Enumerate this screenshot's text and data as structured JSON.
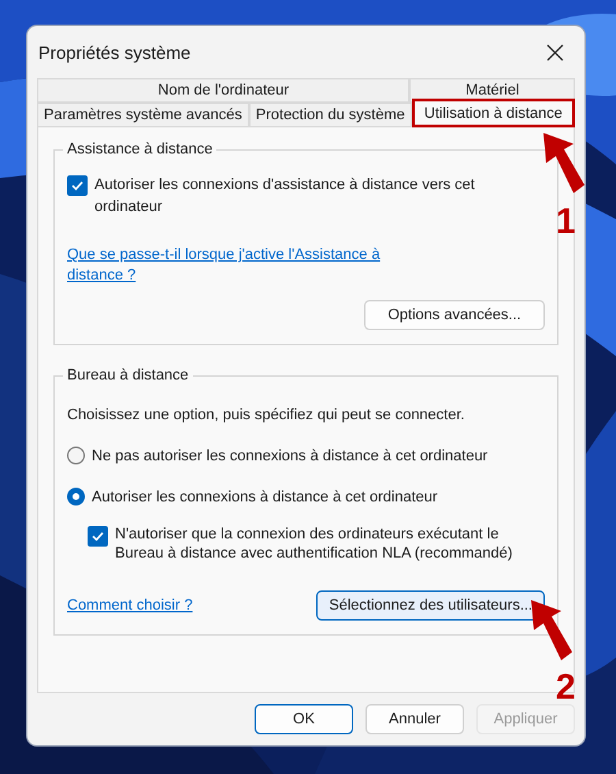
{
  "window": {
    "title": "Propriétés système"
  },
  "tab_rows": [
    {
      "tabs": [
        {
          "label": "Nom de l'ordinateur",
          "selected": false,
          "highlighted": false
        },
        {
          "label": "Matériel",
          "selected": false,
          "highlighted": false
        }
      ]
    },
    {
      "tabs": [
        {
          "label": "Paramètres système avancés",
          "selected": false,
          "highlighted": false
        },
        {
          "label": "Protection du système",
          "selected": false,
          "highlighted": false
        },
        {
          "label": "Utilisation à distance",
          "selected": true,
          "highlighted": true
        }
      ]
    }
  ],
  "remote_assistance": {
    "title": "Assistance à distance",
    "allow": {
      "label": "Autoriser les connexions d'assistance à distance vers cet ordinateur",
      "checked": true
    },
    "help_link": "Que se passe-t-il lorsque j'active l'Assistance à distance ?",
    "advanced_button": "Options avancées..."
  },
  "remote_desktop": {
    "title": "Bureau à distance",
    "instruction": "Choisissez une option, puis spécifiez qui peut se connecter.",
    "options": [
      {
        "label": "Ne pas autoriser les connexions à distance à cet ordinateur",
        "selected": false
      },
      {
        "label": "Autoriser les connexions à distance à cet ordinateur",
        "selected": true
      }
    ],
    "nla": {
      "label": "N'autoriser que la connexion des ordinateurs exécutant le Bureau à distance avec authentification NLA (recommandé)",
      "checked": true
    },
    "help_link": "Comment choisir ?",
    "users_button": "Sélectionnez des utilisateurs..."
  },
  "buttons": [
    {
      "label": "OK",
      "default": true,
      "disabled": false
    },
    {
      "label": "Annuler",
      "default": false,
      "disabled": false
    },
    {
      "label": "Appliquer",
      "default": false,
      "disabled": true
    }
  ],
  "annotations": [
    {
      "number": "1"
    },
    {
      "number": "2"
    }
  ]
}
